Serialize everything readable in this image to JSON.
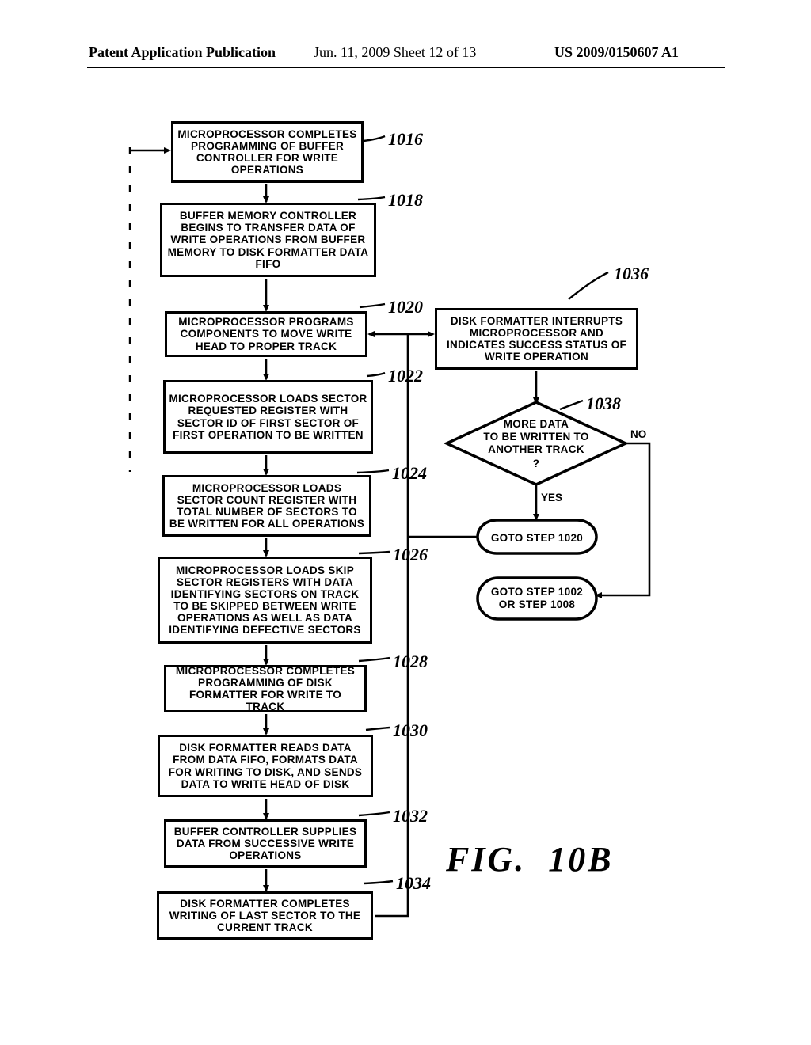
{
  "header": {
    "left": "Patent Application Publication",
    "mid": "Jun. 11, 2009  Sheet 12 of 13",
    "right": "US 2009/0150607 A1"
  },
  "boxes": {
    "b1016": "MICROPROCESSOR COMPLETES PROGRAMMING OF BUFFER CONTROLLER FOR WRITE OPERATIONS",
    "b1018": "BUFFER MEMORY CONTROLLER BEGINS TO TRANSFER DATA OF WRITE OPERATIONS FROM BUFFER MEMORY TO DISK FORMATTER DATA FIFO",
    "b1020": "MICROPROCESSOR PROGRAMS COMPONENTS TO MOVE WRITE HEAD TO PROPER TRACK",
    "b1022": "MICROPROCESSOR LOADS SECTOR REQUESTED REGISTER WITH SECTOR ID OF FIRST SECTOR OF FIRST OPERATION TO BE WRITTEN",
    "b1024": "MICROPROCESSOR LOADS SECTOR COUNT REGISTER WITH TOTAL NUMBER OF SECTORS TO BE WRITTEN FOR ALL OPERATIONS",
    "b1026": "MICROPROCESSOR LOADS SKIP SECTOR REGISTERS WITH DATA IDENTIFYING SECTORS ON TRACK TO BE SKIPPED BETWEEN WRITE OPERATIONS AS WELL AS DATA IDENTIFYING DEFECTIVE SECTORS",
    "b1028": "MICROPROCESSOR COMPLETES PROGRAMMING OF DISK FORMATTER FOR WRITE TO TRACK",
    "b1030": "DISK FORMATTER READS DATA FROM DATA FIFO, FORMATS DATA FOR WRITING TO DISK, AND SENDS DATA TO WRITE HEAD OF DISK",
    "b1032": "BUFFER CONTROLLER SUPPLIES DATA FROM SUCCESSIVE WRITE OPERATIONS",
    "b1034": "DISK FORMATTER COMPLETES WRITING OF LAST SECTOR TO THE CURRENT TRACK",
    "b1036": "DISK FORMATTER INTERRUPTS MICROPROCESSOR AND INDICATES SUCCESS STATUS OF WRITE OPERATION"
  },
  "decision": {
    "lines": [
      "MORE DATA",
      "TO BE WRITTEN TO",
      "ANOTHER TRACK",
      "?"
    ],
    "yes": "YES",
    "no": "NO"
  },
  "goto": {
    "g1020": "GOTO STEP 1020",
    "g1002": "GOTO STEP 1002\nOR STEP 1008"
  },
  "refs": {
    "r1016": "1016",
    "r1018": "1018",
    "r1020": "1020",
    "r1022": "1022",
    "r1024": "1024",
    "r1026": "1026",
    "r1028": "1028",
    "r1030": "1030",
    "r1032": "1032",
    "r1034": "1034",
    "r1036": "1036",
    "r1038": "1038"
  },
  "figure": "FIG.  10B"
}
